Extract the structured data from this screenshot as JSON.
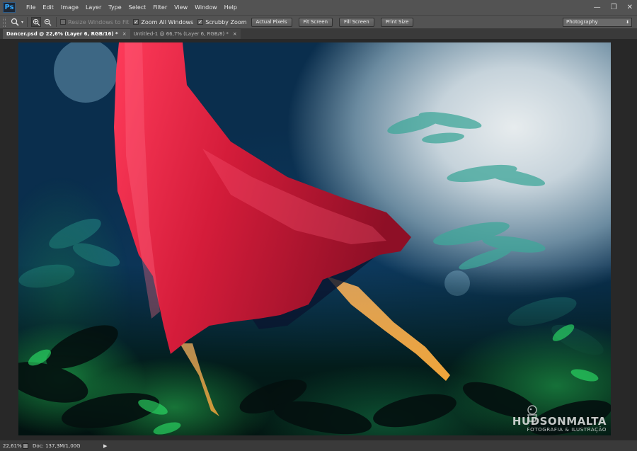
{
  "app": {
    "logo": "Ps"
  },
  "menu": [
    "File",
    "Edit",
    "Image",
    "Layer",
    "Type",
    "Select",
    "Filter",
    "View",
    "Window",
    "Help"
  ],
  "window_controls": {
    "minimize": "—",
    "restore": "❐",
    "close": "✕"
  },
  "options": {
    "tool_icon": "zoom-tool-icon",
    "zoom_in_icon": "zoom-in-icon",
    "zoom_out_icon": "zoom-out-icon",
    "resize_windows": {
      "label": "Resize Windows to Fit",
      "checked": false
    },
    "zoom_all_windows": {
      "label": "Zoom All Windows",
      "checked": true
    },
    "scrubby_zoom": {
      "label": "Scrubby Zoom",
      "checked": true
    },
    "buttons": [
      "Actual Pixels",
      "Fit Screen",
      "Fill Screen",
      "Print Size"
    ],
    "workspace": "Photography"
  },
  "tabs": [
    {
      "title": "Dancer.psd @ 22,6% (Layer 6, RGB/16) *",
      "active": true
    },
    {
      "title": "Untitled-1 @ 66,7% (Layer 6, RGB/8) *",
      "active": false
    }
  ],
  "watermark": {
    "name": "HUDSONMALTA",
    "tagline": "FOTOGRAFIA & ILUSTRAÇÃO"
  },
  "status": {
    "zoom": "22,61%",
    "doc": "Doc: 137,3M/1,00G"
  },
  "colors": {
    "dress": "#d81e3a",
    "sky": "#dfe7eb",
    "night": "#0c3456",
    "foliage": "#2fd56a"
  }
}
